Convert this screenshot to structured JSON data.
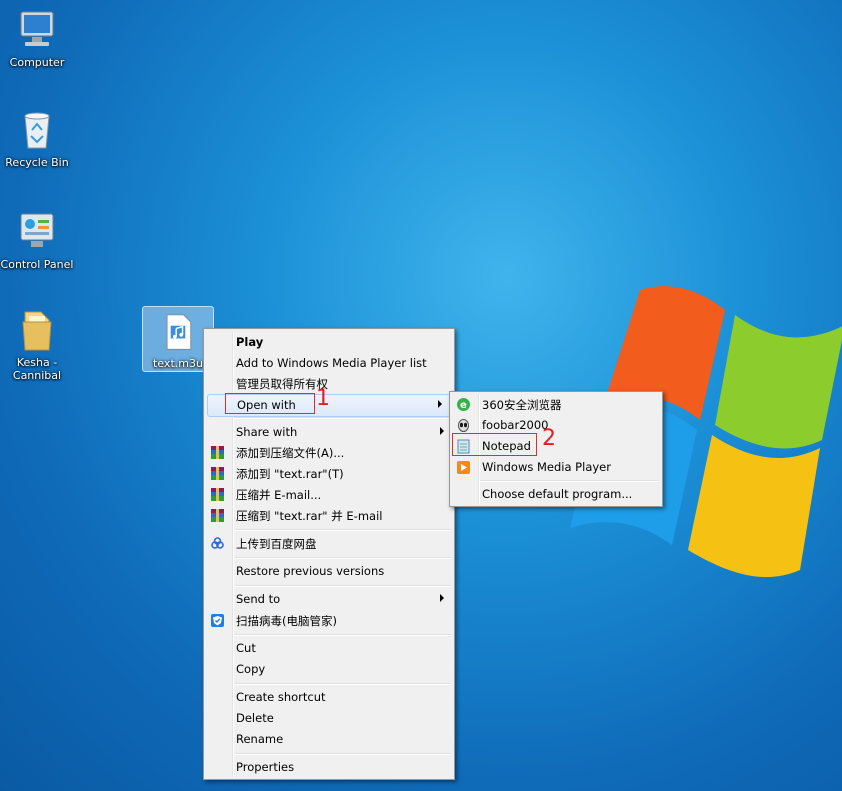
{
  "desktop": {
    "icons": [
      {
        "label": "Computer",
        "icon": "computer-icon"
      },
      {
        "label": "Recycle Bin",
        "icon": "recycle-bin-icon"
      },
      {
        "label": "Control Panel",
        "icon": "control-panel-icon"
      },
      {
        "label": "Kesha - Cannibal",
        "icon": "folder-icon"
      },
      {
        "label": "text.m3u",
        "icon": "playlist-file-icon"
      }
    ]
  },
  "context_menu": {
    "items": [
      {
        "label": "Play",
        "bold": true
      },
      {
        "label": "Add to Windows Media Player list"
      },
      {
        "label": "管理员取得所有权"
      },
      {
        "label": "Open with",
        "submenu": true,
        "highlighted": true
      },
      {
        "label": "Share with",
        "submenu": true
      },
      {
        "label": "添加到压缩文件(A)...",
        "icon": "winrar-icon"
      },
      {
        "label": "添加到 \"text.rar\"(T)",
        "icon": "winrar-icon"
      },
      {
        "label": "压缩并 E-mail...",
        "icon": "winrar-icon"
      },
      {
        "label": "压缩到 \"text.rar\" 并 E-mail",
        "icon": "winrar-icon"
      },
      {
        "label": "上传到百度网盘",
        "icon": "baidu-cloud-icon"
      },
      {
        "label": "Restore previous versions"
      },
      {
        "label": "Send to",
        "submenu": true
      },
      {
        "label": "扫描病毒(电脑管家)",
        "icon": "shield-icon"
      },
      {
        "label": "Cut"
      },
      {
        "label": "Copy"
      },
      {
        "label": "Create shortcut"
      },
      {
        "label": "Delete"
      },
      {
        "label": "Rename"
      },
      {
        "label": "Properties"
      }
    ]
  },
  "open_with_menu": {
    "items": [
      {
        "label": "360安全浏览器",
        "icon": "360-browser-icon"
      },
      {
        "label": "foobar2000",
        "icon": "foobar-icon"
      },
      {
        "label": "Notepad",
        "icon": "notepad-icon",
        "highlighted": true
      },
      {
        "label": "Windows Media Player",
        "icon": "media-player-icon"
      },
      {
        "label": "Choose default program..."
      }
    ]
  },
  "annotations": {
    "step1": "1",
    "step2": "2",
    "color": "#d9312b"
  }
}
